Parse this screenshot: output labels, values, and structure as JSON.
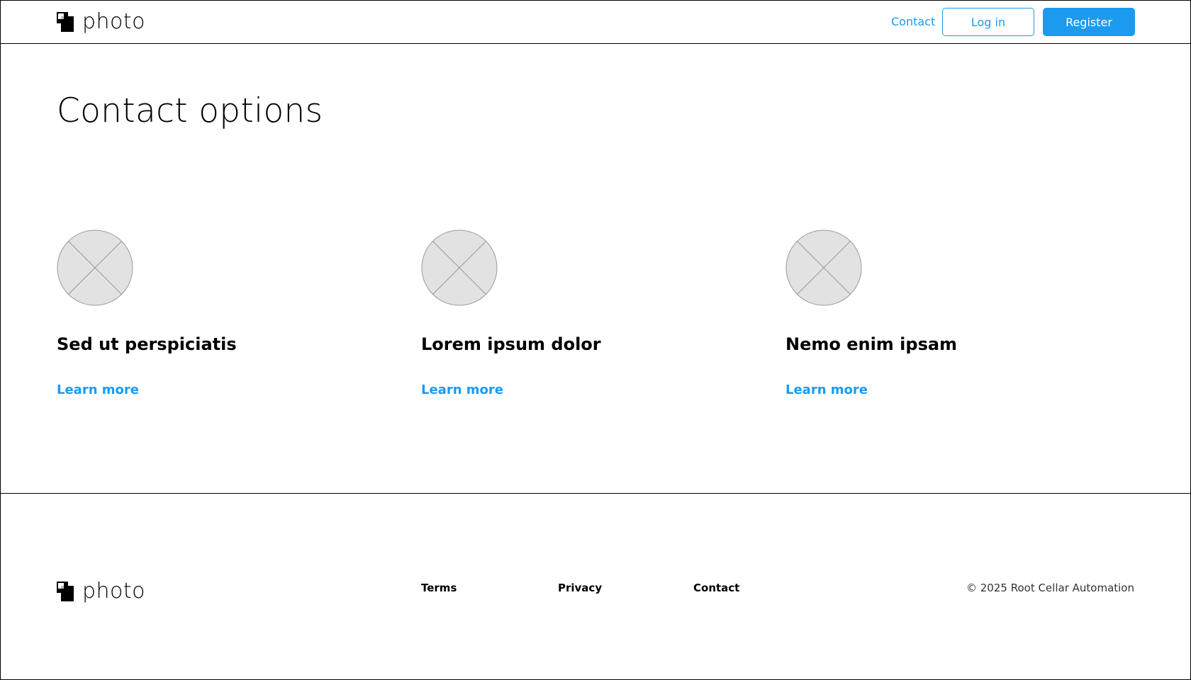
{
  "header": {
    "logo_text": "photo",
    "nav_contact": "Contact",
    "login_label": "Log in",
    "register_label": "Register"
  },
  "main": {
    "title": "Contact options",
    "cards": [
      {
        "title": "Sed ut perspiciatis",
        "link": "Learn more"
      },
      {
        "title": "Lorem ipsum dolor",
        "link": "Learn more"
      },
      {
        "title": "Nemo enim ipsam",
        "link": "Learn more"
      }
    ]
  },
  "footer": {
    "logo_text": "photo",
    "links": [
      "Terms",
      "Privacy",
      "Contact"
    ],
    "copyright": "© 2025 Root Cellar Automation"
  },
  "colors": {
    "accent": "#1a9bf0",
    "placeholder_fill": "#e2e2e2",
    "placeholder_stroke": "#9a9a9a"
  }
}
